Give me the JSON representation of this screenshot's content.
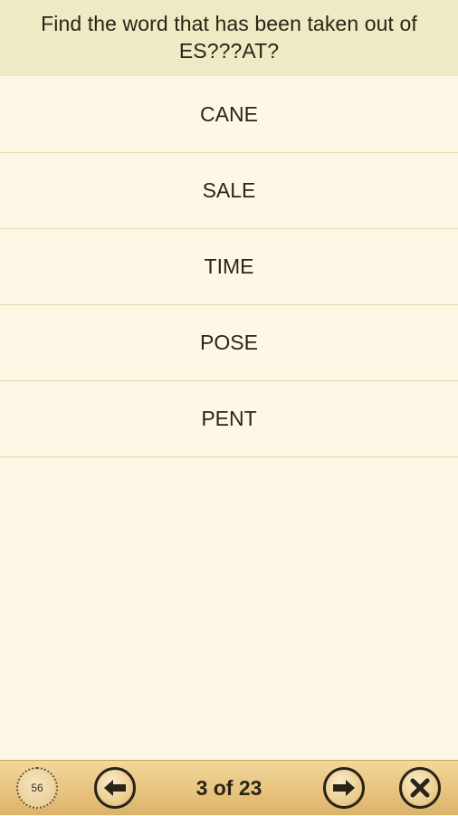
{
  "question": {
    "text": "Find the word that has been taken out of ES???AT?"
  },
  "answers": [
    {
      "label": "CANE"
    },
    {
      "label": "SALE"
    },
    {
      "label": "TIME"
    },
    {
      "label": "POSE"
    },
    {
      "label": "PENT"
    }
  ],
  "toolbar": {
    "timer_value": "56",
    "counter": "3 of 23",
    "prev_icon": "arrow-left-icon",
    "next_icon": "arrow-right-icon",
    "close_icon": "close-icon",
    "timer_icon": "timer-icon"
  },
  "colors": {
    "question_bg": "#ecebc4",
    "page_bg": "#fdf8e6",
    "toolbar_bg": "#e8c47e",
    "text": "#2a2418",
    "divider": "#e4d7ae"
  }
}
